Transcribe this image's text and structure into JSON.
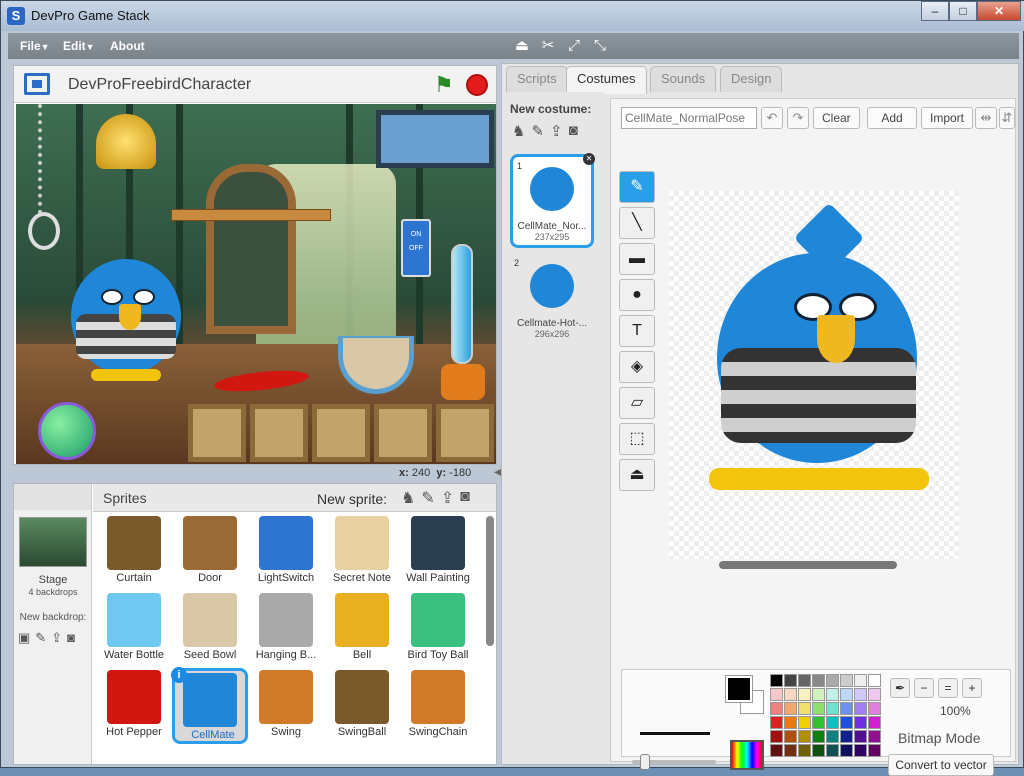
{
  "window": {
    "title": "DevPro Game Stack",
    "icon_letter": "S",
    "min": "–",
    "max": "□",
    "close": "✕"
  },
  "menu": {
    "file": "File",
    "edit": "Edit",
    "about": "About"
  },
  "stage": {
    "project_title": "DevProFreebirdCharacter",
    "coord_x_label": "x:",
    "coord_x": "240",
    "coord_y_label": "y:",
    "coord_y": "-180"
  },
  "sprites_panel": {
    "title": "Sprites",
    "new_sprite_label": "New sprite:",
    "stage_label": "Stage",
    "stage_sub": "4 backdrops",
    "new_backdrop_label": "New backdrop:",
    "sprites": [
      {
        "name": "Curtain"
      },
      {
        "name": "Door"
      },
      {
        "name": "LightSwitch"
      },
      {
        "name": "Secret Note"
      },
      {
        "name": "Wall Painting"
      },
      {
        "name": "Water Bottle"
      },
      {
        "name": "Seed Bowl"
      },
      {
        "name": "Hanging B..."
      },
      {
        "name": "Bell"
      },
      {
        "name": "Bird Toy Ball"
      },
      {
        "name": "Hot Pepper"
      },
      {
        "name": "CellMate"
      },
      {
        "name": "Swing"
      },
      {
        "name": "SwingBall"
      },
      {
        "name": "SwingChain"
      }
    ],
    "selected": "CellMate"
  },
  "tabs": [
    "Scripts",
    "Costumes",
    "Sounds",
    "Design"
  ],
  "active_tab": "Costumes",
  "costumes": {
    "new_costume_label": "New costume:",
    "items": [
      {
        "num": "1",
        "name": "CellMate_Nor...",
        "size": "237x295"
      },
      {
        "num": "2",
        "name": "Cellmate-Hot-...",
        "size": "296x296"
      }
    ]
  },
  "editor": {
    "costume_name": "CellMate_NormalPose",
    "clear": "Clear",
    "add": "Add",
    "import": "Import",
    "zoom": "100%",
    "mode": "Bitmap Mode",
    "convert": "Convert to vector"
  },
  "colors": {
    "accent": "#2a9ee8",
    "fg": "#000000",
    "bg": "#ffffff"
  }
}
